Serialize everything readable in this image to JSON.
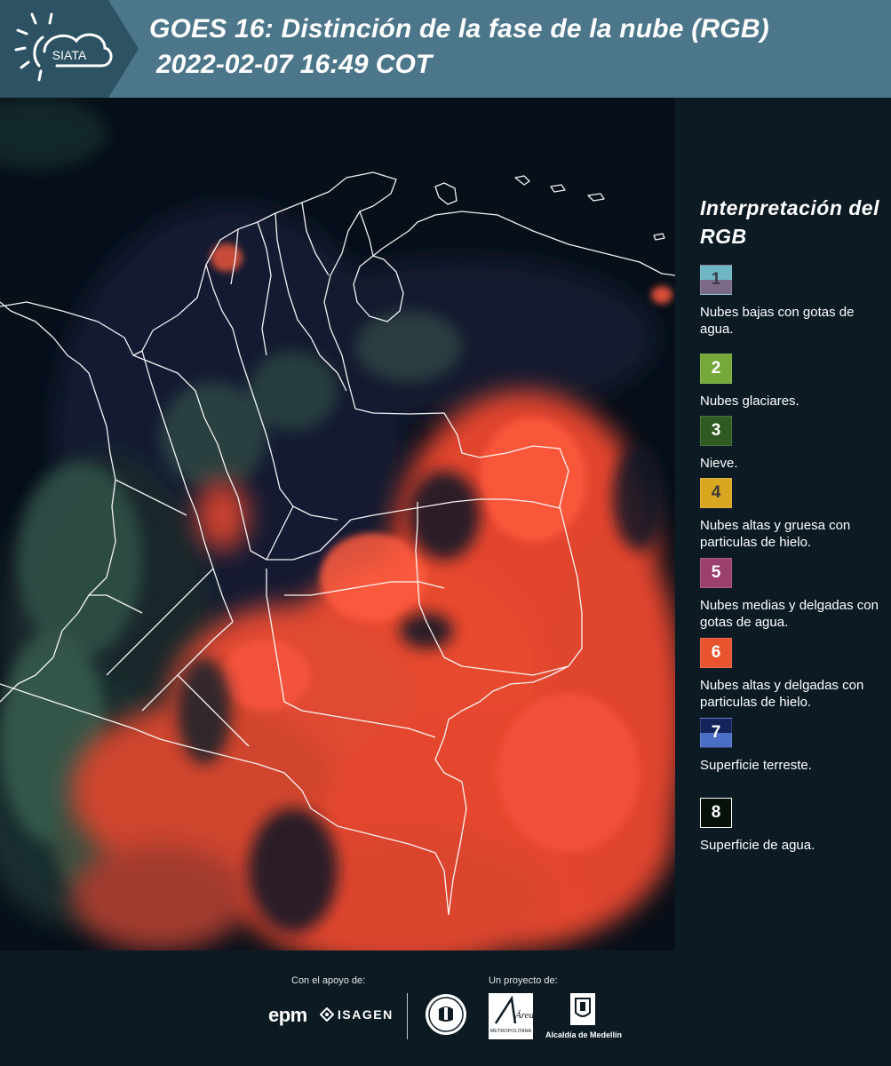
{
  "header": {
    "logo_text": "SIATA",
    "title_line1": "GOES 16: Distinción de la fase de la nube (RGB)",
    "title_line2": "2022-02-07 16:49 COT"
  },
  "legend": {
    "title": "Interpretación del RGB",
    "items": [
      {
        "number": "1",
        "label": "Nubes bajas con gotas de agua.",
        "color_top": "#6fb7c4",
        "color_bottom": "#7a6a86",
        "text_color": "#3a3a4a"
      },
      {
        "number": "2",
        "label": "Nubes glaciares.",
        "color_top": "#76a83a",
        "color_bottom": "#76a83a",
        "text_color": "#ffffff"
      },
      {
        "number": "3",
        "label": "Nieve.",
        "color_top": "#2f5a22",
        "color_bottom": "#2f5a22",
        "text_color": "#ffffff"
      },
      {
        "number": "4",
        "label": "Nubes altas y gruesa con particulas de hielo.",
        "color_top": "#d9a620",
        "color_bottom": "#d9a620",
        "text_color": "#3a3a3a"
      },
      {
        "number": "5",
        "label": "Nubes medias y delgadas con gotas de agua.",
        "color_top": "#9b3f6f",
        "color_bottom": "#9b3f6f",
        "text_color": "#ffffff"
      },
      {
        "number": "6",
        "label": "Nubes altas y delgadas con particulas de hielo.",
        "color_top": "#e8532e",
        "color_bottom": "#e8532e",
        "text_color": "#ffffff"
      },
      {
        "number": "7",
        "label": "Superficie terreste.",
        "color_top": "#14245a",
        "color_bottom": "#4a6fc4",
        "text_color": "#ffffff"
      },
      {
        "number": "8",
        "label": "Superficie de agua.",
        "color_top": "#061208",
        "color_bottom": "#061208",
        "text_color": "#ffffff"
      }
    ]
  },
  "footer": {
    "support_label": "Con el apoyo de:",
    "project_label": "Un proyecto de:",
    "sponsor1": "epm",
    "sponsor2": "ISAGEN",
    "partner1_caption": "Área",
    "partner1_sub": "METROPOLITANA",
    "partner2": "Alcaldía de Medellín"
  },
  "colors": {
    "header_bg": "#4c7689",
    "logo_bg": "#2d5263",
    "panel_bg": "#0c1a24",
    "cloud_red": "#f0432a",
    "border_white": "#ffffff"
  }
}
